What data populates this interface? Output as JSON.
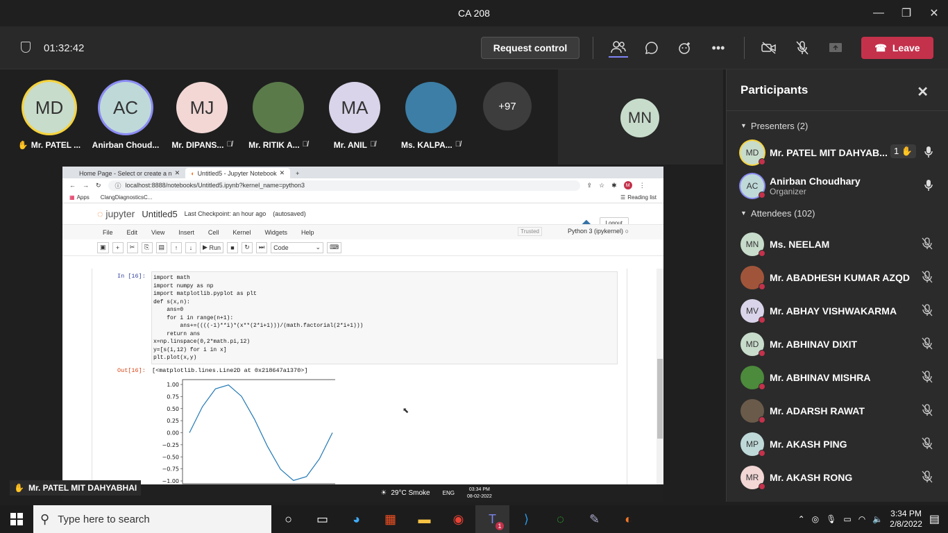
{
  "window": {
    "title": "CA 208"
  },
  "meeting": {
    "timer": "01:32:42",
    "request_control": "Request control",
    "leave": "Leave"
  },
  "stage_avatars": [
    {
      "initials": "MD",
      "name": "Mr. PATEL ...",
      "color": "#c8dccb",
      "ring": "#f6d33c",
      "hand": "✋"
    },
    {
      "initials": "AC",
      "name": "Anirban Choud...",
      "color": "#bfd9d9",
      "ring": "#8b8cf4"
    },
    {
      "initials": "MJ",
      "name": "Mr. DIPANS...",
      "color": "#f2d7d5",
      "mic": "off"
    },
    {
      "initials": "",
      "name": "Mr. RITIK A...",
      "color": "#5a7a4a",
      "photo": true,
      "mic": "off"
    },
    {
      "initials": "MA",
      "name": "Mr. ANIL",
      "color": "#d9d4ea",
      "mic": "off"
    },
    {
      "initials": "",
      "name": "Ms. KALPA...",
      "color": "#3c7ea6",
      "photo": true,
      "mic": "off"
    },
    {
      "initials": "+97",
      "name": "",
      "color": "#3d3d3d"
    }
  ],
  "spotlight": {
    "initials": "MN"
  },
  "browser": {
    "tab1": "Home Page - Select or create a n",
    "tab2": "Untitled5 - Jupyter Notebook",
    "url": "localhost:8888/notebooks/Untitled5.ipynb?kernel_name=python3",
    "bookmark_apps": "Apps",
    "bookmark_clang": "ClangDiagnosticsC...",
    "reading_list": "Reading list"
  },
  "jupyter": {
    "logo": "jupyter",
    "notebook": "Untitled5",
    "checkpoint": "Last Checkpoint: an hour ago",
    "autosaved": "(autosaved)",
    "logout": "Logout",
    "menu": [
      "File",
      "Edit",
      "View",
      "Insert",
      "Cell",
      "Kernel",
      "Widgets",
      "Help"
    ],
    "trusted": "Trusted",
    "kernel": "Python 3 (ipykernel)",
    "run": "Run",
    "cell_type": "Code",
    "in_prompt": "In [16]:",
    "out_prompt": "Out[16]:",
    "code": "import math\nimport numpy as np\nimport matplotlib.pyplot as plt\ndef s(x,n):\n    ans=0\n    for i in range(n+1):\n        ans+=((((-1)**i)*(x**(2*i+1)))/(math.factorial(2*i+1)))\n    return ans\nx=np.linspace(0,2*math.pi,12)\ny=[s(i,12) for i in x]\nplt.plot(x,y)",
    "output": "[<matplotlib.lines.Line2D at 0x218647a1370>]"
  },
  "chart_data": {
    "type": "line",
    "x": [
      0,
      0.571,
      1.142,
      1.714,
      2.285,
      2.856,
      3.427,
      3.998,
      4.57,
      5.141,
      5.712,
      6.283
    ],
    "y": [
      0.0,
      0.541,
      0.91,
      0.99,
      0.756,
      0.282,
      -0.282,
      -0.756,
      -0.99,
      -0.91,
      -0.541,
      0.0
    ],
    "yticks": [
      "1.00",
      "0.75",
      "0.50",
      "0.25",
      "0.00",
      "−0.25",
      "−0.50",
      "−0.75",
      "−1.00"
    ],
    "ylim": [
      -1.0,
      1.0
    ],
    "color": "#1f77b4"
  },
  "inner_taskbar": {
    "weather": "29°C  Smoke",
    "lang": "ENG",
    "time": "03:34 PM",
    "date": "08-02-2022"
  },
  "presenter_label": "Mr. PATEL MIT DAHYABHAI",
  "participants": {
    "title": "Participants",
    "presenters_label": "Presenters (2)",
    "attendees_label": "Attendees (102)",
    "presenters": [
      {
        "initials": "MD",
        "name": "Mr. PATEL MIT DAHYAB...",
        "color": "#c8dccb",
        "ring": "#f6d33c",
        "badge": "1 ✋"
      },
      {
        "initials": "AC",
        "name": "Anirban Choudhary",
        "sub": "Organizer",
        "color": "#bfd9d9",
        "ring": "#8b8cf4"
      }
    ],
    "attendees": [
      {
        "initials": "MN",
        "name": "Ms. NEELAM",
        "color": "#c8dccb"
      },
      {
        "initials": "",
        "name": "Mr. ABADHESH KUMAR AZQD",
        "color": "#a0553a",
        "photo": true
      },
      {
        "initials": "MV",
        "name": "Mr. ABHAY VISHWAKARMA",
        "color": "#d9d4ea"
      },
      {
        "initials": "MD",
        "name": "Mr. ABHINAV DIXIT",
        "color": "#c8dccb"
      },
      {
        "initials": "",
        "name": "Mr. ABHINAV MISHRA",
        "color": "#4c8a3c",
        "photo": true
      },
      {
        "initials": "",
        "name": "Mr. ADARSH RAWAT",
        "color": "#6a5a4a",
        "photo": true
      },
      {
        "initials": "MP",
        "name": "Mr. AKASH PING",
        "color": "#bfd9d9"
      },
      {
        "initials": "MR",
        "name": "Mr. AKASH RONG",
        "color": "#f2d7d5"
      }
    ]
  },
  "taskbar": {
    "search_placeholder": "Type here to search",
    "time": "3:34 PM",
    "date": "2/8/2022",
    "notif_count": "1"
  }
}
